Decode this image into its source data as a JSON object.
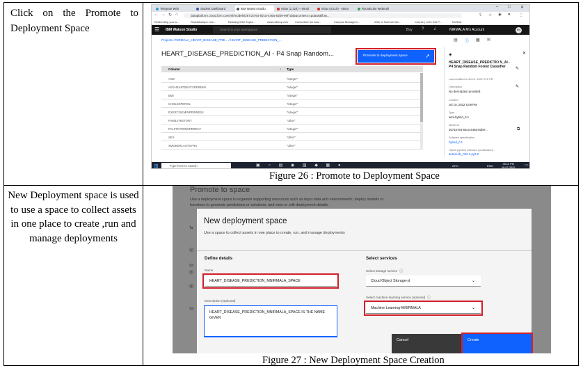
{
  "rows": [
    {
      "description": "Click on the Promote to Deployment Space",
      "caption": "Figure 26 : Promote to Deployment Space"
    },
    {
      "description": "New Deployment space is used to use a space to collect assets in one place to create ,run and manage deployments",
      "caption": "Figure 27 : New Deployment Space Creation"
    }
  ],
  "fig26": {
    "tabs": [
      "Telegram Web",
      "Student Dashboard",
      "IBM Watson Studio",
      "Inbox (2,124) - nirmal",
      "Inbox (4,610) - nirma",
      "Roundcube Webmail"
    ],
    "url": "dataplatform.cloud.ibm.com/ml/models/26715764-82ca-446a-83b9-9ef7dab&context=cpdaas&flow...",
    "bookmarks": [
      "Redirecting you to...",
      "Readaholique Live...",
      "Reading Wire Expla...",
      "www.udemy.com",
      "Consortium for Aca...",
      "Campus Managem...",
      "Web of Science Ma...",
      "Course | Let's Get P...",
      "NVIDIA"
    ],
    "ibm_title": "IBM Watson Studio",
    "search_placeholder": "Search in your workspaces",
    "buy": "Buy",
    "account": "NIRMALA M's Account",
    "avatar": "NM",
    "breadcrumb": "Projects / NIRMALA_HEART_DISEASE_PRE... / HEART_DISEASE_PREDICTION_...",
    "asset_title": "HEART_DISEASE_PREDICTION_AI - P4 Snap Random...",
    "promote_label": "Promote to deployment space",
    "columns_header": [
      "Column",
      "Type"
    ],
    "columns": [
      [
        "AGE",
        "\"integer\""
      ],
      [
        "AVGHEARTBEATSPERMIN",
        "\"integer\""
      ],
      [
        "BMI",
        "\"integer\""
      ],
      [
        "CHOLESTEROL",
        "\"integer\""
      ],
      [
        "EXERCISEMINPERWEEK",
        "\"integer\""
      ],
      [
        "FAMILYHISTORY",
        "\"other\""
      ],
      [
        "PALPITATIONSPERDAY",
        "\"integer\""
      ],
      [
        "SEX",
        "\"other\""
      ],
      [
        "SMOKERLASTSYRS",
        "\"other\""
      ]
    ],
    "panel": {
      "name": "HEART_DISEASE_PREDICTIO N_AI - P4 Snap Random Forest Classifier",
      "modified": "Last modified at Jul 19, 2022 5:10 PM",
      "desc_label": "Description",
      "desc_value": "No description provided.",
      "created_label": "Created",
      "created_value": "Jul 19, 2022 5:09 PM",
      "type_label": "Type",
      "type_value": "wml-hybrid_0.1",
      "model_id_label": "Model ID",
      "model_id_value": "26715764-82ca-446a-83b9-...",
      "spec_label": "Software specification",
      "spec_value": "hybrid_0.1",
      "pipeline_label": "Hybrid pipeline software specifications",
      "pipeline_value": "autoai-kb_rt22.1-py3.9"
    },
    "taskbar": {
      "search": "Type here to search",
      "weather": "29°C",
      "lang": "ENG",
      "time": "05:12 PM",
      "date": "19-07-2022"
    }
  },
  "fig27": {
    "bg_title": "Promote to space",
    "bg_desc": "Use a deployment space to organize supporting resources such as input data and environments; deploy models or functions to generate predictions or solutions; and view or edit deployment details.",
    "modal_title": "New deployment space",
    "modal_subtitle": "Use a space to collect assets in one place to create, run, and manage deployments",
    "define_heading": "Define details",
    "name_label": "Name",
    "name_value": "HEART_DISEASE_PREDICTION_MNIRMALA_SPACE",
    "desc_label": "Description (Optional)",
    "desc_value": "HEART_DISEASE_PREDICTION_MNIRMALA_SPACE IS THE NAME GIVEN",
    "services_heading": "Select services",
    "storage_label": "Select storage service",
    "storage_value": "Cloud Object Storage-xt",
    "ml_label": "Select machine learning service (optional)",
    "ml_value": "Machine Learning-MNIRMALA",
    "cancel": "Cancel",
    "create": "Create"
  },
  "colors": {
    "ibm_blue": "#0f62fe",
    "highlight_red": "#d21f2a",
    "ibm_dark": "#161616"
  }
}
